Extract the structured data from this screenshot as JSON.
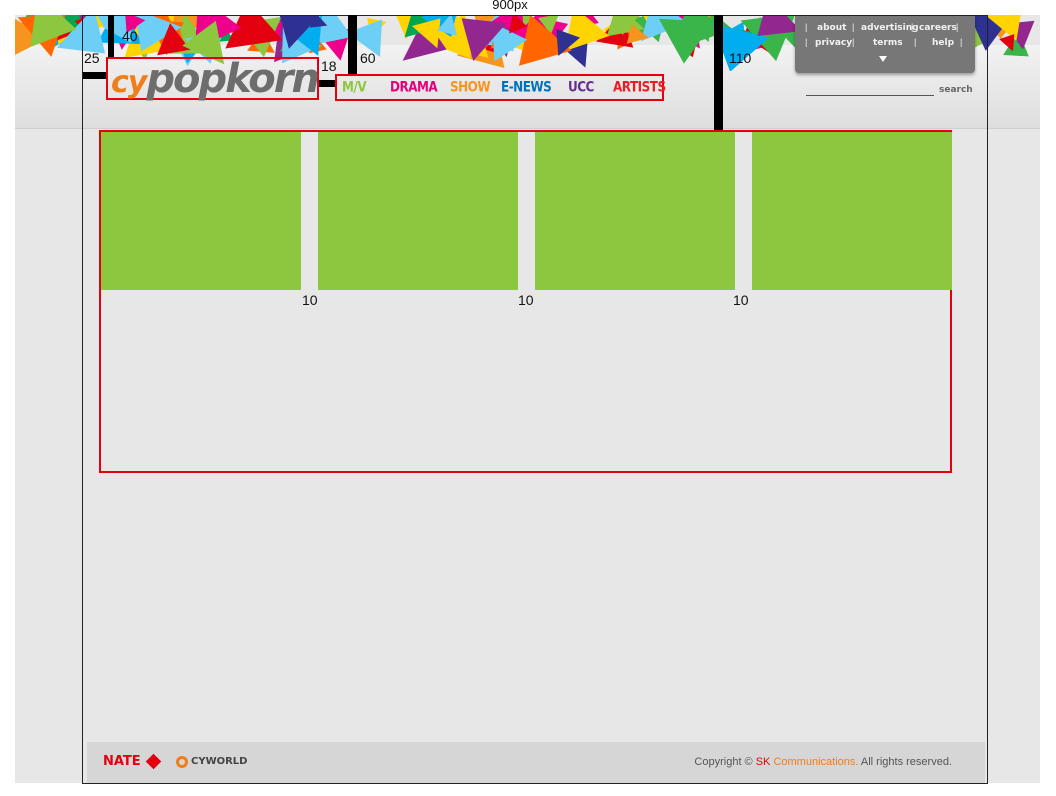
{
  "colors": {
    "accent_red": "#e3000f",
    "tile_green": "#8dc63f",
    "brand_orange": "#ef7d1a",
    "brand_gray": "#6d6d6d"
  },
  "width_label": "900px",
  "dimensions": {
    "left_margin": "25",
    "logo_top": "40",
    "logo_gap": "18",
    "nav_top": "60",
    "content_top": "110",
    "gutter_1": "10",
    "gutter_2": "10",
    "gutter_3": "10"
  },
  "logo": {
    "cy": "cy",
    "popkorn": "popkorn"
  },
  "nav": {
    "items": [
      {
        "label": "M/V",
        "color": "#8dc63f"
      },
      {
        "label": "DRAMA",
        "color": "#e6007e"
      },
      {
        "label": "SHOW",
        "color": "#f7941d"
      },
      {
        "label": "E-NEWS",
        "color": "#0072bc"
      },
      {
        "label": "UCC",
        "color": "#662d91"
      },
      {
        "label": "ARTISTS",
        "color": "#ed1c24"
      }
    ]
  },
  "util_menu": {
    "links": [
      "about",
      "advertising",
      "careers",
      "privacy",
      "terms",
      "help"
    ],
    "separator": "|",
    "expand_icon": "triangle-down-icon"
  },
  "search": {
    "label": "search"
  },
  "content": {
    "tile_count": 4
  },
  "footer": {
    "nate": "NATE",
    "cyworld": "CYWORLD",
    "copyright_prefix": "Copyright © ",
    "copyright_sk": "SK",
    "copyright_comm": " Communications.",
    "copyright_suffix": " All rights reserved."
  }
}
